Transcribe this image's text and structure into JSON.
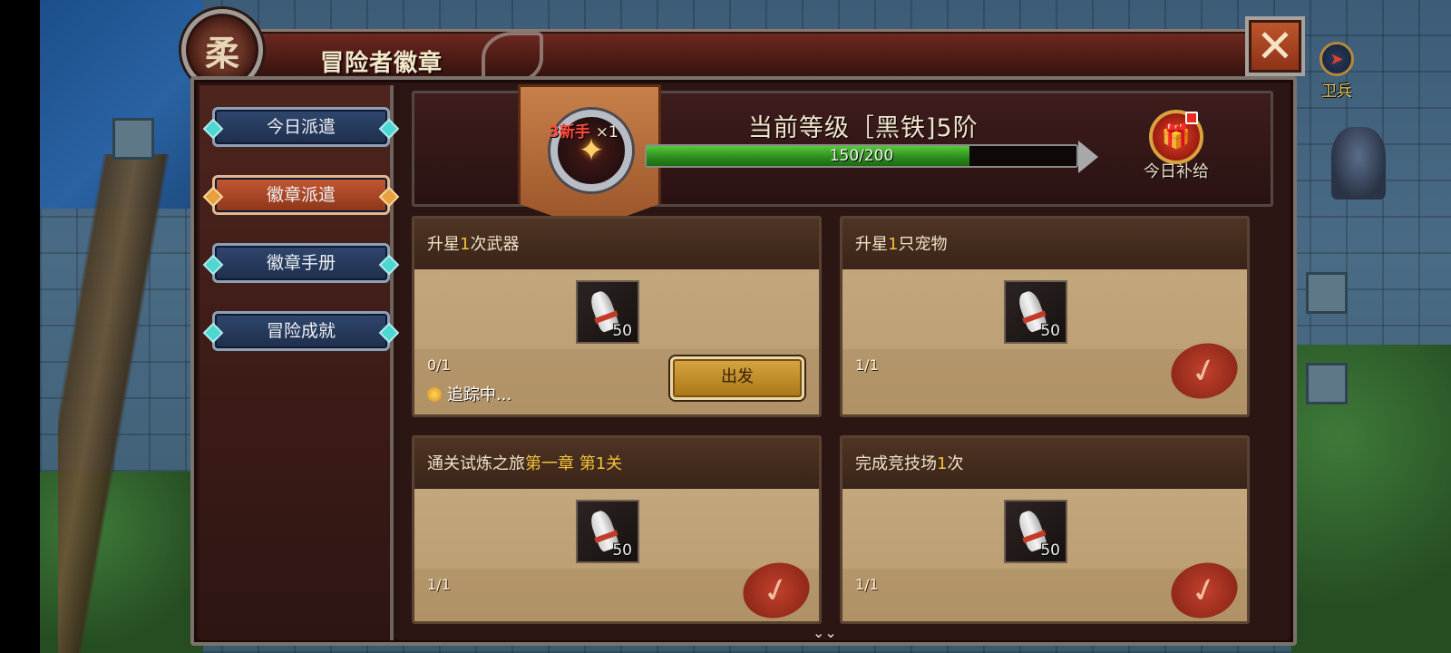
{
  "window": {
    "title": "冒险者徽章",
    "emblem_icon": "rank-emblem-icon",
    "close_icon": "close-x-icon"
  },
  "hud": {
    "guard_label": "卫兵",
    "guard_icon": "compass-icon"
  },
  "sidebar": {
    "items": [
      {
        "label": "今日派遣",
        "active": false
      },
      {
        "label": "徽章派遣",
        "active": true
      },
      {
        "label": "徽章手册",
        "active": false
      },
      {
        "label": "冒险成就",
        "active": false
      }
    ]
  },
  "rank": {
    "badge_tag": "3新手",
    "badge_count": "×1",
    "title": "当前等级［黑铁]5阶",
    "progress_text": "150/200",
    "progress_current": 150,
    "progress_max": 200,
    "progress_color": "#3aa82a",
    "daily_gift_label": "今日补给",
    "daily_gift_icon": "gift-box-icon"
  },
  "tasks": [
    {
      "title_prefix": "升星",
      "title_hl": "1",
      "title_suffix": "次武器",
      "item_qty": "50",
      "count": "0/1",
      "tracking": "追踪中...",
      "action": "出发",
      "done": false
    },
    {
      "title_prefix": "升星",
      "title_hl": "1",
      "title_suffix": "只宠物",
      "item_qty": "50",
      "count": "1/1",
      "done": true
    },
    {
      "title_prefix": "通关试炼之旅",
      "title_hl": "第一章 第1关",
      "title_suffix": "",
      "item_qty": "50",
      "count": "1/1",
      "done": true
    },
    {
      "title_prefix": "完成竞技场",
      "title_hl": "1",
      "title_suffix": "次",
      "item_qty": "50",
      "count": "1/1",
      "done": true
    }
  ],
  "scroll_hint": "⌄⌄"
}
